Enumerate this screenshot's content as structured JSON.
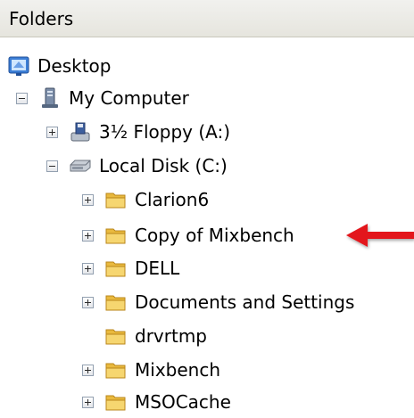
{
  "panel": {
    "title": "Folders"
  },
  "tree": {
    "desktop": "Desktop",
    "my_computer": "My Computer",
    "floppy": "3½ Floppy (A:)",
    "local_disk": "Local Disk (C:)",
    "folders": [
      "Clarion6",
      "Copy of Mixbench",
      "DELL",
      "Documents and Settings",
      "drvrtmp",
      "Mixbench",
      "MSOCache"
    ]
  },
  "colors": {
    "arrow": "#e3141b",
    "folder": "#f5d36a",
    "header_bg": "#ebeae4"
  },
  "icons": {
    "desktop": "desktop-icon",
    "computer": "computer-icon",
    "floppy": "floppy-drive-icon",
    "disk": "hard-disk-icon",
    "folder": "folder-icon",
    "expand": "plus-box-icon",
    "collapse": "minus-box-icon"
  }
}
